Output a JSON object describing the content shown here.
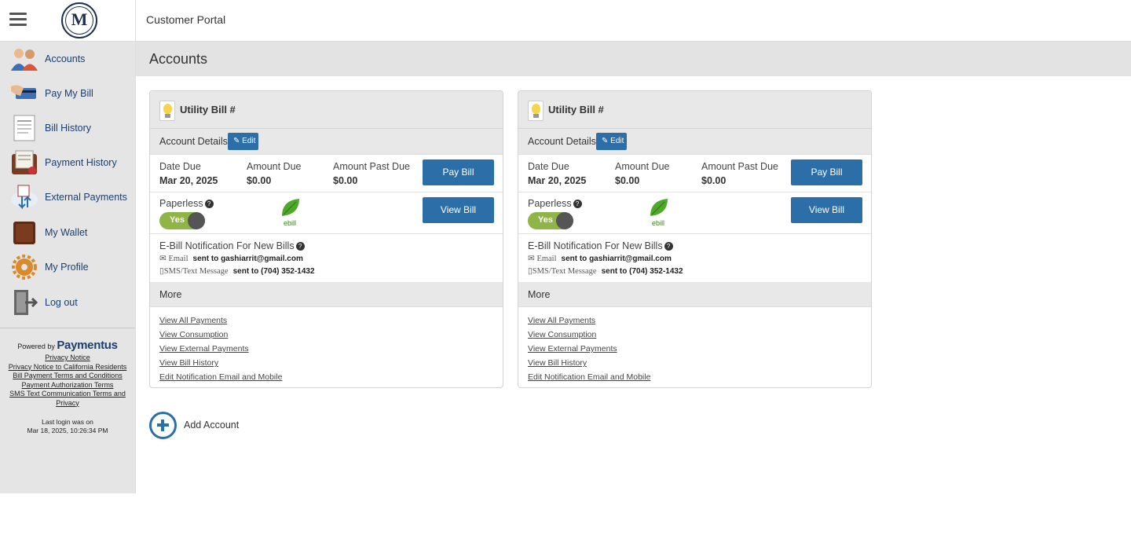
{
  "header": {
    "portal_title": "Customer Portal"
  },
  "sidebar": {
    "items": [
      {
        "label": "Accounts",
        "icon": "accounts-icon"
      },
      {
        "label": "Pay My Bill",
        "icon": "pay-bill-icon"
      },
      {
        "label": "Bill History",
        "icon": "bill-history-icon"
      },
      {
        "label": "Payment History",
        "icon": "payment-history-icon"
      },
      {
        "label": "External Payments",
        "icon": "external-payments-icon"
      },
      {
        "label": "My Wallet",
        "icon": "wallet-icon"
      },
      {
        "label": "My Profile",
        "icon": "profile-gear-icon"
      },
      {
        "label": "Log out",
        "icon": "logout-icon"
      }
    ],
    "powered_by": "Powered by",
    "brand": "Paymentus",
    "legal_links": [
      "Privacy Notice",
      "Privacy Notice to California Residents",
      "Bill Payment Terms and Conditions",
      "Payment Authorization Terms",
      "SMS Text Communication Terms and Privacy"
    ],
    "last_login_label": "Last login was on",
    "last_login_value": "Mar 18, 2025, 10:26:34 PM"
  },
  "page": {
    "title": "Accounts"
  },
  "accounts": [
    {
      "title": "Utility Bill #",
      "details_label": "Account Details",
      "edit_label": "Edit",
      "date_due_label": "Date Due",
      "date_due": "Mar 20, 2025",
      "amount_due_label": "Amount Due",
      "amount_due": "$0.00",
      "past_due_label": "Amount Past Due",
      "past_due": "$0.00",
      "pay_label": "Pay Bill",
      "view_label": "View Bill",
      "paperless_label": "Paperless",
      "paperless_toggle": "Yes",
      "ebill_label": "ebill",
      "notify_title": "E-Bill Notification For New Bills",
      "email_kind": "Email",
      "email_sent": "sent to gashiarrit@gmail.com",
      "sms_kind": "SMS/Text Message",
      "sms_sent": "sent to (704) 352-1432",
      "more_label": "More",
      "links": [
        "View All Payments",
        "View Consumption",
        "View External Payments",
        "View Bill History",
        "Edit Notification Email and Mobile"
      ]
    },
    {
      "title": "Utility Bill #",
      "details_label": "Account Details",
      "edit_label": "Edit",
      "date_due_label": "Date Due",
      "date_due": "Mar 20, 2025",
      "amount_due_label": "Amount Due",
      "amount_due": "$0.00",
      "past_due_label": "Amount Past Due",
      "past_due": "$0.00",
      "pay_label": "Pay Bill",
      "view_label": "View Bill",
      "paperless_label": "Paperless",
      "paperless_toggle": "Yes",
      "ebill_label": "ebill",
      "notify_title": "E-Bill Notification For New Bills",
      "email_kind": "Email",
      "email_sent": "sent to gashiarrit@gmail.com",
      "sms_kind": "SMS/Text Message",
      "sms_sent": "sent to (704) 352-1432",
      "more_label": "More",
      "links": [
        "View All Payments",
        "View Consumption",
        "View External Payments",
        "View Bill History",
        "Edit Notification Email and Mobile"
      ]
    }
  ],
  "add_account_label": "Add Account",
  "colors": {
    "accent": "#2c6fa8",
    "toggle_on": "#8fb447",
    "sidebar_bg": "#e5e5e5",
    "nav_text": "#1b3f6e"
  }
}
